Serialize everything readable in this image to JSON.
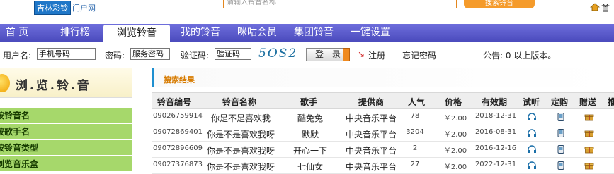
{
  "header": {
    "logo_brand": "吉林彩铃",
    "logo_suffix": "门户网",
    "search_placeholder": "请输入铃音名称",
    "search_button": "搜索铃音",
    "home_link": "首"
  },
  "nav": {
    "items": [
      {
        "label": "首 页",
        "active": false
      },
      {
        "label": "排行榜",
        "active": false
      },
      {
        "label": "浏览铃音",
        "active": true
      },
      {
        "label": "我的铃音",
        "active": false
      },
      {
        "label": "咪咕会员",
        "active": false
      },
      {
        "label": "集团铃音",
        "active": false
      },
      {
        "label": "一键设置",
        "active": false
      }
    ]
  },
  "login": {
    "username_label": "用户名:",
    "username_value": "手机号码",
    "password_label": "密码:",
    "password_value": "服务密码",
    "captcha_label": "验证码:",
    "captcha_value": "验证码",
    "captcha_image_text": "5OS2",
    "login_button": "登 录",
    "register_link": "注册",
    "forgot_link": "忘记密码",
    "notice": "公告: 0 以上版本。"
  },
  "sidebar": {
    "title": "浏.览.铃.音",
    "items": [
      {
        "label": "按铃音名"
      },
      {
        "label": "按歌手名"
      },
      {
        "label": "按铃音类型"
      },
      {
        "label": "浏览音乐盒"
      }
    ]
  },
  "results": {
    "title": "搜索结果",
    "columns": [
      "铃音编号",
      "铃音名称",
      "歌手",
      "提供商",
      "人气",
      "价格",
      "有效期",
      "试听",
      "定购",
      "赠送",
      "推"
    ],
    "rows": [
      {
        "id": "09026759914",
        "name": "你是不是喜欢我",
        "singer": "酷兔兔",
        "provider": "中央音乐平台",
        "popularity": "78",
        "price": "￥2.00",
        "expiry": "2018-12-31"
      },
      {
        "id": "09072869401",
        "name": "你是不是喜欢我呀",
        "singer": "默默",
        "provider": "中央音乐平台",
        "popularity": "3204",
        "price": "￥2.00",
        "expiry": "2016-08-31"
      },
      {
        "id": "09072896609",
        "name": "你是不是喜欢我呀",
        "singer": "开心一下",
        "provider": "中央音乐平台",
        "popularity": "2",
        "price": "￥2.00",
        "expiry": "2016-12-16"
      },
      {
        "id": "09027376873",
        "name": "你是不是喜欢我呀",
        "singer": "七仙女",
        "provider": "中央音乐平台",
        "popularity": "27",
        "price": "￥2.00",
        "expiry": "2022-12-31"
      }
    ]
  },
  "icons": {
    "listen": "headphones-icon",
    "order": "phone-icon",
    "gift": "gift-icon",
    "accent": "#4b4bbd",
    "sidebar_green": "#a6d86b",
    "orange": "#f08a1e"
  }
}
